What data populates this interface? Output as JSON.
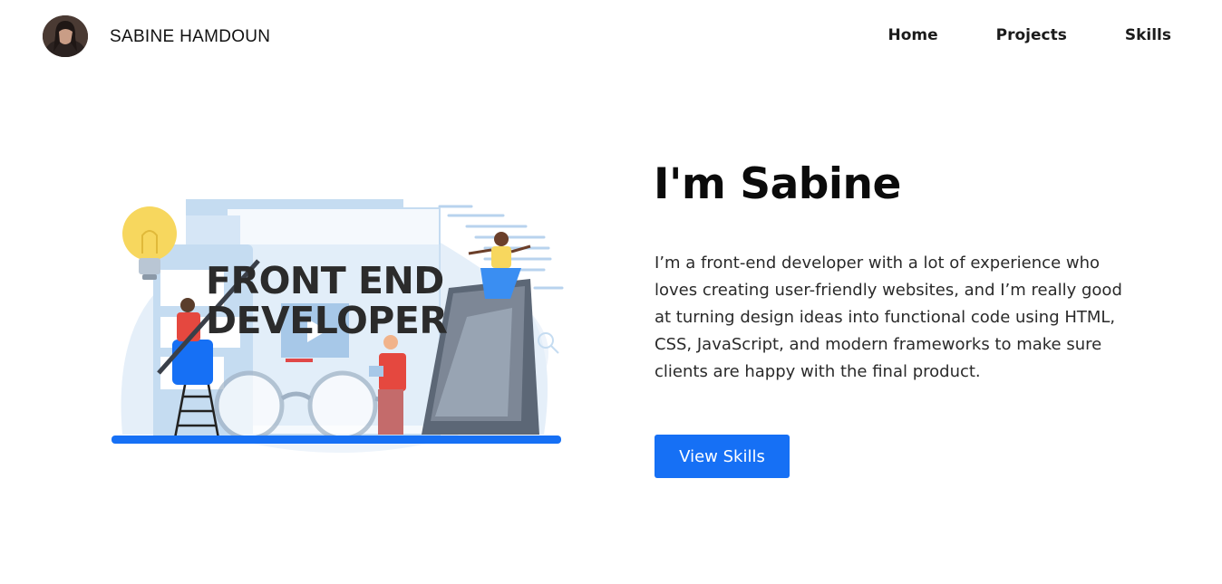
{
  "header": {
    "brand": "SABINE HAMDOUN",
    "nav": [
      {
        "label": "Home"
      },
      {
        "label": "Projects"
      },
      {
        "label": "Skills"
      }
    ]
  },
  "hero": {
    "illustration_text_line1": "FRONT END",
    "illustration_text_line2": "DEVELOPER",
    "title": "I'm Sabine",
    "description": "I’m a front-end developer with a lot of experience who loves creating user-friendly websites, and I’m really good at turning design ideas into functional code using HTML, CSS, JavaScript, and modern frameworks to make sure clients are happy with the final product.",
    "cta_label": "View Skills"
  },
  "colors": {
    "accent": "#1670f5",
    "text_dark": "#0b0b0b",
    "illustration_light_blue": "#d6e6f6",
    "bulb_yellow": "#f7d75e"
  },
  "icons": [
    "avatar",
    "light-bulb-icon",
    "glasses-icon",
    "phone-icon",
    "search-icon",
    "play-icon",
    "close-icon"
  ]
}
